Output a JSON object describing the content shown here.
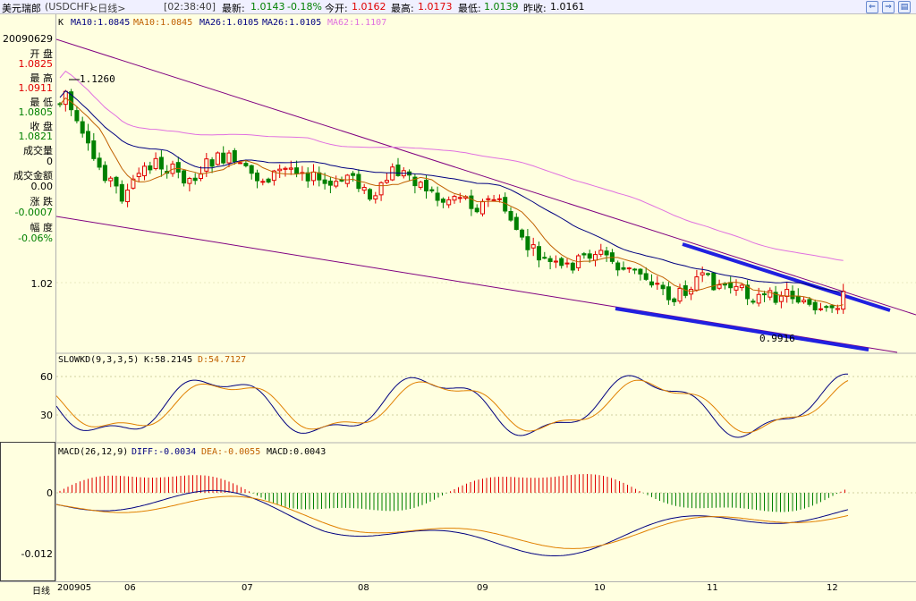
{
  "header": {
    "name": "美元瑞郎",
    "code": "(USDCHF)",
    "period": "<日线>",
    "time": "[02:38:40]",
    "latest_label": "最新:",
    "latest": "1.0143",
    "change": "-0.18%",
    "open_label": "今开:",
    "open": "1.0162",
    "high_label": "最高:",
    "high": "1.0173",
    "low_label": "最低:",
    "low": "1.0139",
    "prev_label": "昨收:",
    "prev": "1.0161"
  },
  "ma_legend": {
    "k": "K",
    "ma10a": "MA10:1.0845",
    "ma10b": "MA10:1.0845",
    "ma26a": "MA26:1.0105",
    "ma26b": "MA26:1.0105",
    "ma62": "MA62:1.1107"
  },
  "side": {
    "date": "20090629",
    "open_label": "开 盘",
    "open": "1.0825",
    "high_label": "最 高",
    "high": "1.0911",
    "low_label": "最 低",
    "low": "1.0805",
    "close_label": "收 盘",
    "close": "1.0821",
    "vol_label": "成交量",
    "vol": "0",
    "amount_label": "成交金额",
    "amount": "0.00",
    "chg_label": "涨 跌",
    "chg": "-0.0007",
    "pct_label": "幅 度",
    "pct": "-0.06%"
  },
  "price_axis": {
    "t1": "1.02"
  },
  "annotations": {
    "high_mark": "1.1260",
    "low_mark": "0.9916"
  },
  "kd": {
    "label": "SLOWKD(9,3,3,5)",
    "k": "K:58.2145",
    "d": "D:54.7127",
    "y60": "60",
    "y30": "30"
  },
  "macd": {
    "label": "MACD(26,12,9)",
    "diff": "DIFF:-0.0034",
    "dea": "DEA:-0.0055",
    "macd": "MACD:0.0043",
    "y0": "0",
    "y1": "-0.012"
  },
  "xaxis": {
    "label": "日线",
    "ticks": [
      "200905",
      "06",
      "07",
      "08",
      "09",
      "10",
      "11",
      "12"
    ]
  },
  "colors": {
    "up": "#e00000",
    "down": "#008000",
    "ma10": "#c06000",
    "ma26": "#000080",
    "ma62": "#e070e0",
    "trend": "#2020e0",
    "channel": "#800080"
  },
  "chart_data": {
    "type": "candlestick",
    "title": "美元瑞郎(USDCHF)<日线>",
    "x_ticks": [
      "200905",
      "06",
      "07",
      "08",
      "09",
      "10",
      "11",
      "12"
    ],
    "y_ticks": [
      "1.02"
    ],
    "annotations": [
      "1.1260",
      "0.9916"
    ]
  }
}
